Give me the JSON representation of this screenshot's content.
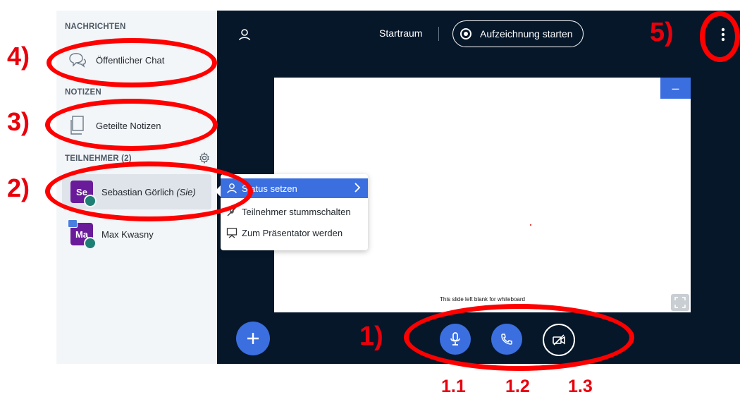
{
  "sidebar": {
    "messages_title": "NACHRICHTEN",
    "public_chat_label": "Öffentlicher Chat",
    "notes_title": "NOTIZEN",
    "shared_notes_label": "Geteilte Notizen",
    "participants_title": "TEILNEHMER (2)",
    "users": [
      {
        "initials": "Se",
        "name": "Sebastian Görlich",
        "suffix": "(Sie)"
      },
      {
        "initials": "Ma",
        "name": "Max Kwasny",
        "suffix": ""
      }
    ]
  },
  "context_menu": {
    "items": [
      {
        "label": "Status setzen"
      },
      {
        "label": "Teilnehmer stummschalten"
      },
      {
        "label": "Zum Präsentator werden"
      }
    ]
  },
  "topbar": {
    "room_name": "Startraum",
    "record_label": "Aufzeichnung starten"
  },
  "presentation": {
    "caption": "This slide left blank for whiteboard",
    "minimize_label": "–"
  },
  "annotations": {
    "one": "1)",
    "two": "2)",
    "three": "3)",
    "four": "4)",
    "five": "5)",
    "mic": "1.1",
    "phone": "1.2",
    "cam": "1.3"
  },
  "colors": {
    "accent": "#3b6fe0",
    "main_bg": "#06172a",
    "sidebar_bg": "#f3f6f9",
    "annotation_red": "#ff0000",
    "avatar_purple": "#6a1b9a"
  }
}
